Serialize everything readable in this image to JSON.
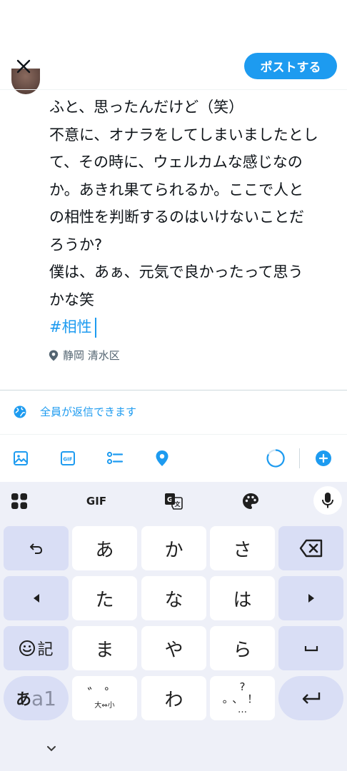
{
  "header": {
    "post_button_label": "ポストする"
  },
  "composer": {
    "lines": [
      "ふと、思ったんだけど（笑）",
      "不意に、オナラをしてしまいましたとし",
      "て、その時に、ウェルカムな感じなの",
      "か。あきれ果てられるか。ここで人と",
      "の相性を判断するのはいけないことだ",
      "ろうか?",
      "僕は、あぁ、元気で良かったって思う",
      "かな笑"
    ],
    "hashtag": "#相性"
  },
  "location": {
    "label": "静岡 清水区"
  },
  "reply_setting": {
    "label": "全員が返信できます"
  },
  "toolbar": {
    "icons": [
      "image-icon",
      "gif-icon",
      "poll-icon",
      "location-pin-icon",
      "character-count-ring",
      "add-post-icon"
    ],
    "accent": "#1d9bf0"
  },
  "keyboard": {
    "top_bar": {
      "gif_label": "GIF"
    },
    "keys": {
      "a": "あ",
      "ka": "か",
      "sa": "さ",
      "ta": "た",
      "na": "な",
      "ha": "は",
      "ma": "ま",
      "ya": "や",
      "ra": "ら",
      "wa": "わ",
      "emoji_symbols": "記",
      "mode_kana": "あ",
      "mode_alpha": "a1",
      "dakuten_top": "゛゜",
      "dakuten_bottom": "大⇔小",
      "punct_top": "?",
      "punct_mid": "。、！",
      "punct_bottom": "…"
    },
    "colors": {
      "background": "#eef0f8",
      "function_key": "#d9def5",
      "key": "#ffffff"
    }
  }
}
